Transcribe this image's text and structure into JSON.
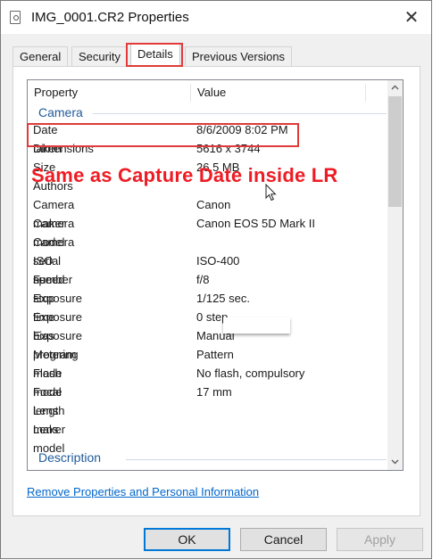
{
  "window": {
    "title": "IMG_0001.CR2 Properties"
  },
  "tabs": [
    {
      "label": "General",
      "active": false
    },
    {
      "label": "Security",
      "active": false
    },
    {
      "label": "Details",
      "active": true
    },
    {
      "label": "Previous Versions",
      "active": false
    }
  ],
  "columns": {
    "property": "Property",
    "value": "Value"
  },
  "groups": {
    "camera": "Camera",
    "description": "Description"
  },
  "rows": [
    {
      "property": "Date taken",
      "value": "8/6/2009 8:02 PM"
    },
    {
      "property": "Dimensions",
      "value": "5616 x 3744"
    },
    {
      "property": "Size",
      "value": "26.5 MB"
    },
    {
      "property": "Authors",
      "value": ""
    },
    {
      "property": "Camera maker",
      "value": "Canon"
    },
    {
      "property": "Camera model",
      "value": "Canon EOS 5D Mark II"
    },
    {
      "property": "Camera serial number",
      "value": ""
    },
    {
      "property": "ISO speed",
      "value": "ISO-400"
    },
    {
      "property": "F-stop",
      "value": "f/8"
    },
    {
      "property": "Exposure time",
      "value": "1/125 sec."
    },
    {
      "property": "Exposure bias",
      "value": "0 step"
    },
    {
      "property": "Exposure program",
      "value": "Manual"
    },
    {
      "property": "Metering mode",
      "value": "Pattern"
    },
    {
      "property": "Flash mode",
      "value": "No flash, compulsory"
    },
    {
      "property": "Focal length",
      "value": "17 mm"
    },
    {
      "property": "Lens maker",
      "value": ""
    },
    {
      "property": "Lens model",
      "value": ""
    }
  ],
  "annotation": {
    "text": "Same as Capture Date inside LR",
    "color": "#ee1c24"
  },
  "link": {
    "label": "Remove Properties and Personal Information"
  },
  "buttons": {
    "ok": "OK",
    "cancel": "Cancel",
    "apply": "Apply"
  },
  "colors": {
    "accent": "#0078d7",
    "highlight_red": "#e03a3a",
    "group_label": "#1e5a9a",
    "link": "#0066cc"
  },
  "icons": {
    "title": "file-icon",
    "close": "close-icon",
    "scroll_up": "chevron-up-icon",
    "scroll_down": "chevron-down-icon",
    "cursor": "mouse-pointer-icon"
  }
}
